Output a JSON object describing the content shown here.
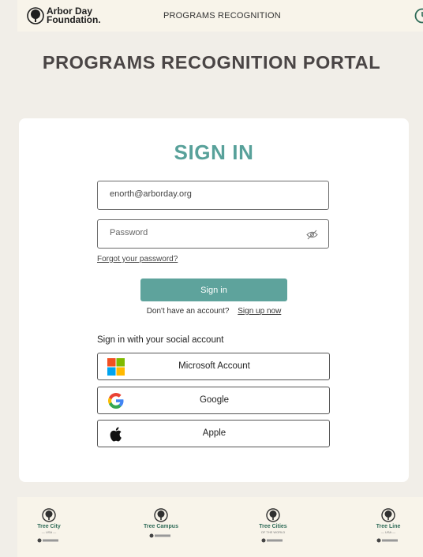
{
  "nav": {
    "logo_line1": "Arbor Day",
    "logo_line2": "Foundation.",
    "link": "PROGRAMS RECOGNITION",
    "icon": "user-circle-icon"
  },
  "page": {
    "title": "PROGRAMS RECOGNITION PORTAL"
  },
  "signin": {
    "heading": "SIGN IN",
    "email_value": "enorth@arborday.org",
    "password_placeholder": "Password",
    "forgot_link": "Forgot your password?",
    "submit_label": "Sign in",
    "no_account_text": "Don't have an account?",
    "signup_link": "Sign up now",
    "social_heading": "Sign in with your social account",
    "social": [
      {
        "label": "Microsoft Account",
        "icon": "microsoft-icon"
      },
      {
        "label": "Google",
        "icon": "google-icon"
      },
      {
        "label": "Apple",
        "icon": "apple-icon"
      }
    ]
  },
  "footer": {
    "logos": [
      {
        "name": "Tree City",
        "sub": "— USA —",
        "icon": "tree-icon"
      },
      {
        "name": "Tree Campus",
        "sub": "",
        "icon": "tree-icon"
      },
      {
        "name": "Tree Cities",
        "sub": "OF THE WORLD",
        "icon": "tree-icon"
      },
      {
        "name": "Tree Line",
        "sub": "— USA —",
        "icon": "tree-icon"
      }
    ]
  },
  "colors": {
    "accent": "#58a19a",
    "button": "#5ea39c",
    "title": "#4a4545",
    "nav_bg": "#f8f4ea"
  }
}
